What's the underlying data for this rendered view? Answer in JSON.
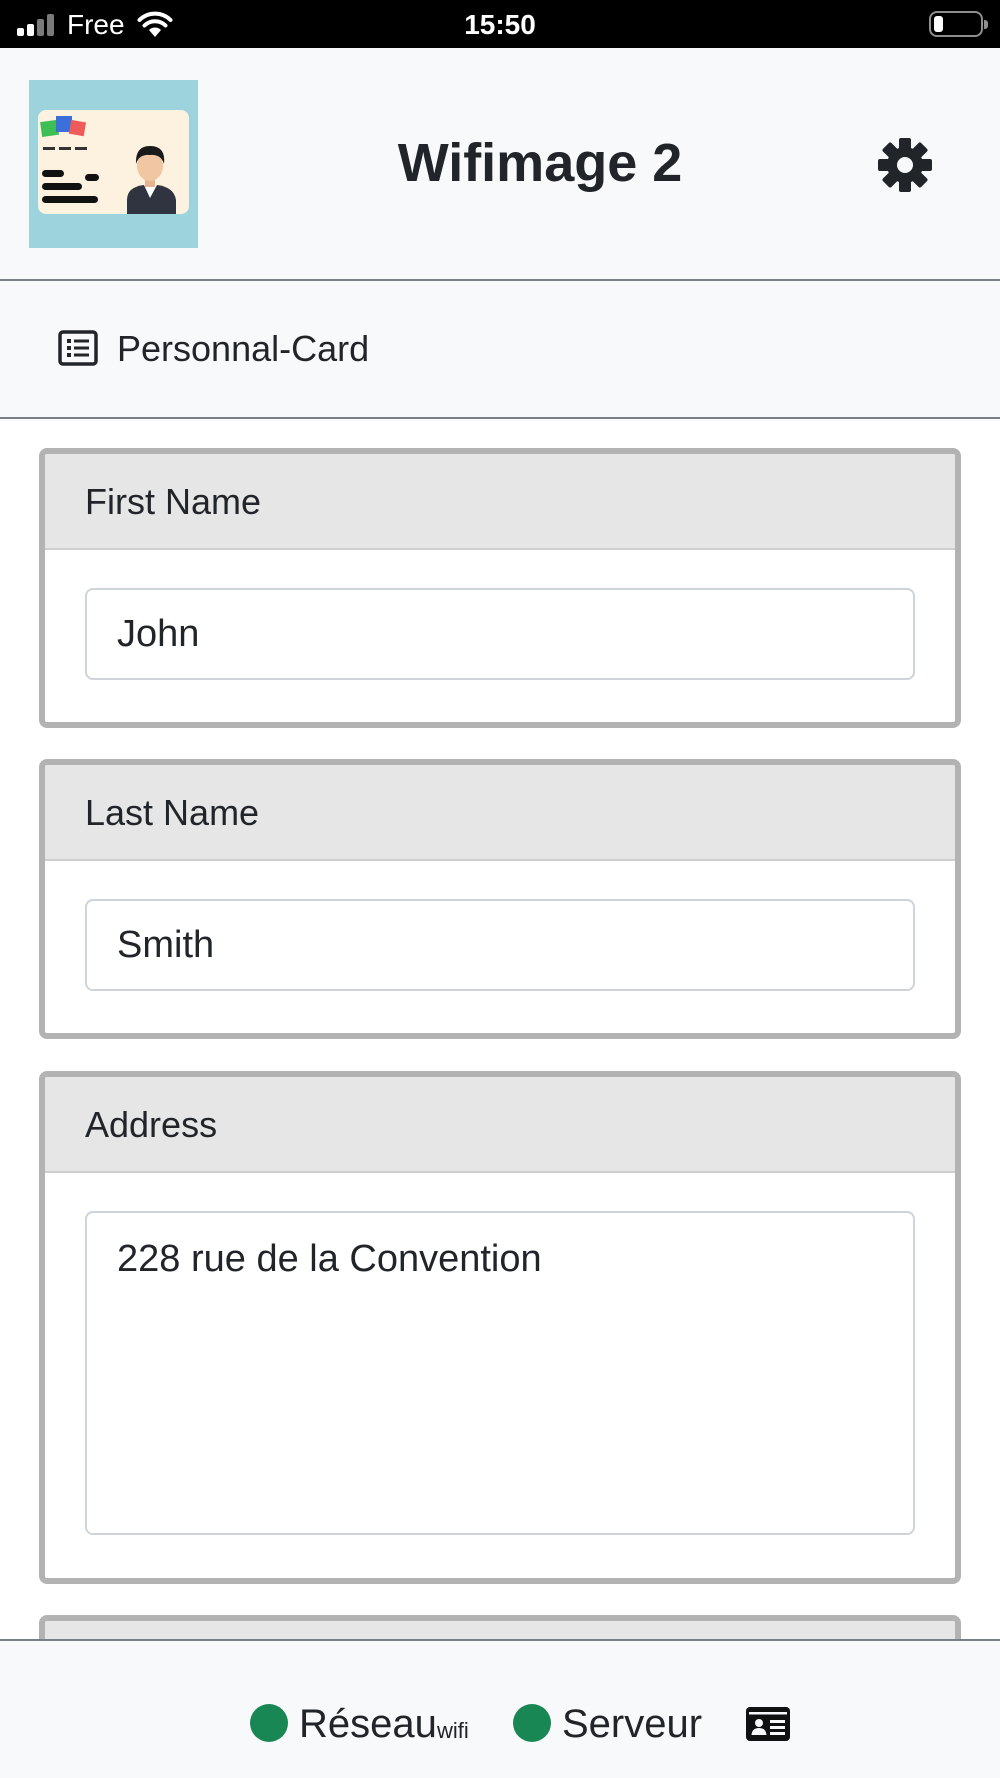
{
  "status_bar": {
    "carrier": "Free",
    "time": "15:50",
    "signal_bars_active": 2,
    "signal_bars_total": 4,
    "battery_level": 0.2
  },
  "header": {
    "title": "Wifimage 2",
    "logo_icon": "id-card-logo-icon",
    "settings_icon": "gear-icon"
  },
  "section": {
    "icon": "list-alt-icon",
    "label": "Personnal-Card"
  },
  "fields": [
    {
      "label": "First Name",
      "value": "John"
    },
    {
      "label": "Last Name",
      "value": "Smith"
    },
    {
      "label": "Address",
      "value": "228 rue de la Convention"
    }
  ],
  "footer": {
    "network_label": "Réseau",
    "network_sublabel": "wifi",
    "server_label": "Serveur",
    "status_color": "#198754",
    "card_icon": "id-card-icon"
  }
}
